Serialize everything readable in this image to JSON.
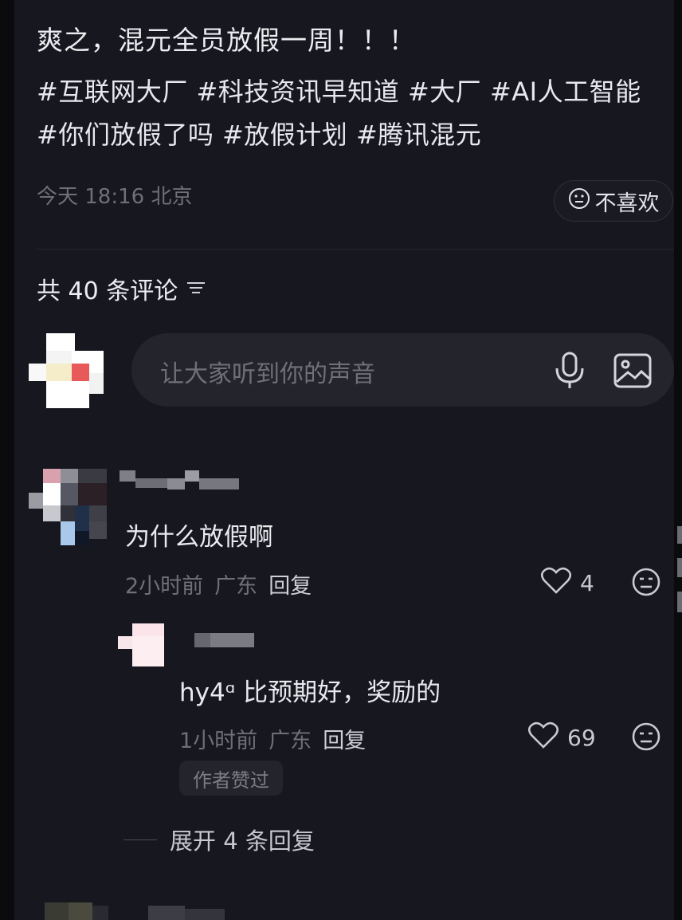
{
  "post": {
    "title": "爽之，混元全员放假一周！！！",
    "tags": "#互联网大厂 #科技资讯早知道 #大厂 #AI人工智能 #你们放假了吗 #放假计划 #腾讯混元",
    "time": "今天 18:16 北京",
    "dislike_label": "不喜欢"
  },
  "comments_header": {
    "count_label": "共 40 条评论"
  },
  "input": {
    "placeholder": "让大家听到你的声音"
  },
  "comments": [
    {
      "text": "为什么放假啊",
      "time": "2小时前",
      "location": "广东",
      "reply_label": "回复",
      "likes": "4",
      "reply": {
        "text": "hy4ᵅ 比预期好，奖励的",
        "time": "1小时前",
        "location": "广东",
        "reply_label": "回复",
        "likes": "69",
        "badge": "作者赞过"
      },
      "expand_label": "展开 4 条回复"
    }
  ],
  "colors": {
    "background": "#17171f",
    "text": "#e9eaee",
    "muted": "#6e6f78"
  }
}
